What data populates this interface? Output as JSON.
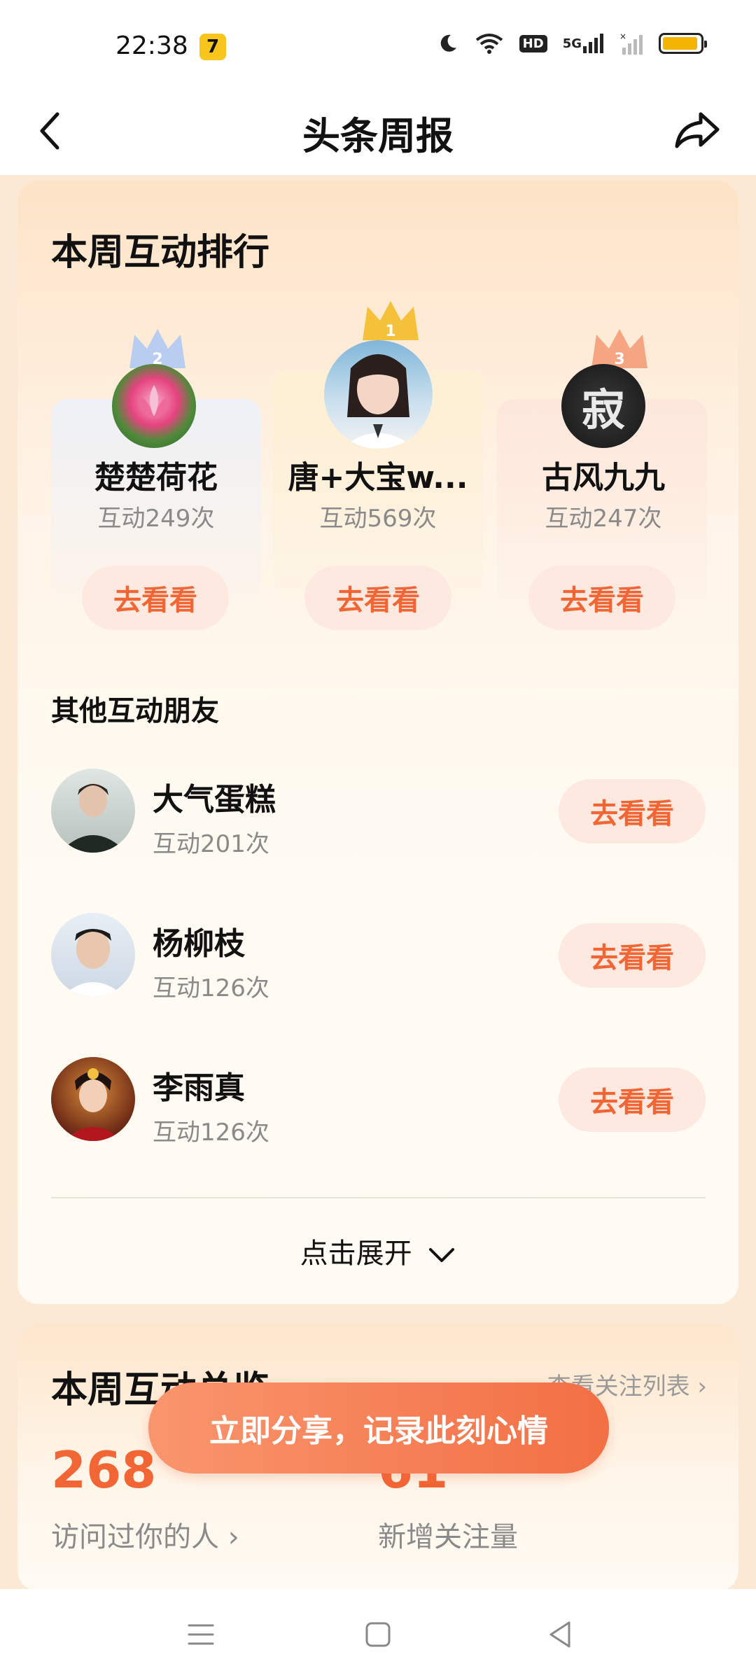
{
  "status_bar": {
    "time": "22:38",
    "app_icon": "7",
    "hd_label": "HD",
    "sig_label": "5G",
    "battery_level": 0.95,
    "battery_color": "#f5b400"
  },
  "nav": {
    "title": "头条周报",
    "back_icon": "chevron-left-icon",
    "share_icon": "share-icon"
  },
  "ranking": {
    "title": "本周互动排行",
    "top3": [
      {
        "rank": "2",
        "name": "楚楚荷花",
        "count": "互动249次",
        "button": "去看看"
      },
      {
        "rank": "1",
        "name": "唐+大宝w...",
        "count": "互动569次",
        "button": "去看看"
      },
      {
        "rank": "3",
        "name": "古风九九",
        "count": "互动247次",
        "button": "去看看"
      }
    ],
    "avatar3_text": "寂",
    "others_title": "其他互动朋友",
    "others": [
      {
        "name": "大气蛋糕",
        "count": "互动201次",
        "button": "去看看"
      },
      {
        "name": "杨柳枝",
        "count": "互动126次",
        "button": "去看看"
      },
      {
        "name": "李雨真",
        "count": "互动126次",
        "button": "去看看"
      }
    ],
    "expand_label": "点击展开"
  },
  "overview": {
    "title": "本周互动总览",
    "link": "查看关注列表 ›",
    "visitors_value": "268",
    "visitors_label": "访问过你的人 ›",
    "follows_value": "61",
    "follows_label": "新增关注量"
  },
  "share_button": "立即分享，记录此刻心情",
  "colors": {
    "accent": "#f26535",
    "pill_bg": "#fde9df",
    "gold": "#f5c03a",
    "silver": "#b9cdf0",
    "bronze": "#f6a582"
  },
  "system_nav": [
    "menu-icon",
    "home-icon",
    "back-icon"
  ]
}
